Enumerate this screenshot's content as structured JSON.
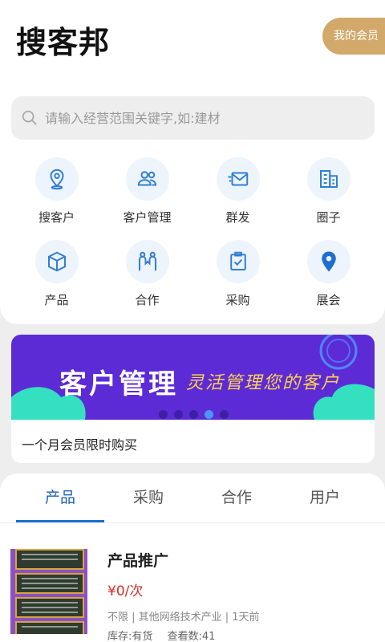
{
  "header": {
    "title": "搜客邦",
    "member_button": "我的会员"
  },
  "search": {
    "placeholder": "请输入经营范围关键字,如:建材"
  },
  "grid": [
    {
      "label": "搜客户",
      "icon": "location-pin-icon"
    },
    {
      "label": "客户管理",
      "icon": "users-icon"
    },
    {
      "label": "群发",
      "icon": "mail-icon"
    },
    {
      "label": "圈子",
      "icon": "buildings-icon"
    },
    {
      "label": "产品",
      "icon": "box-icon"
    },
    {
      "label": "合作",
      "icon": "handshake-icon"
    },
    {
      "label": "采购",
      "icon": "clipboard-check-icon"
    },
    {
      "label": "展会",
      "icon": "map-marker-icon"
    }
  ],
  "banner": {
    "title": "客户管理",
    "subtitle": "灵活管理您的客户",
    "active_dot": 4,
    "caption": "一个月会员限时购买"
  },
  "tabs": [
    "产品",
    "采购",
    "合作",
    "用户"
  ],
  "active_tab": 0,
  "product": {
    "title": "产品推广",
    "price": "¥0/次",
    "meta": "不限 | 其他网络技术产业 | 1天前",
    "stock": "库存:有货",
    "views": "查看数:41"
  },
  "colors": {
    "accent": "#1e6fd0",
    "member": "#d2a96b",
    "price": "#d0302a",
    "banner": "#5c2bd6"
  }
}
